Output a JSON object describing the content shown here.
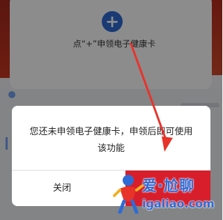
{
  "card": {
    "add_symbol": "+",
    "hint": "点“+”申领电子健康卡"
  },
  "dialog": {
    "message": "您还未申领电子健康卡，申领后即可使用该功能",
    "close_label": "关闭",
    "confirm_label": ""
  },
  "watermark": {
    "line1": "爱·尬聊",
    "line2": "igaliao.com"
  },
  "colors": {
    "brand_blue": "#2f6bd6",
    "confirm_red": "#d81e2a",
    "annotation_red": "#e8332a"
  }
}
